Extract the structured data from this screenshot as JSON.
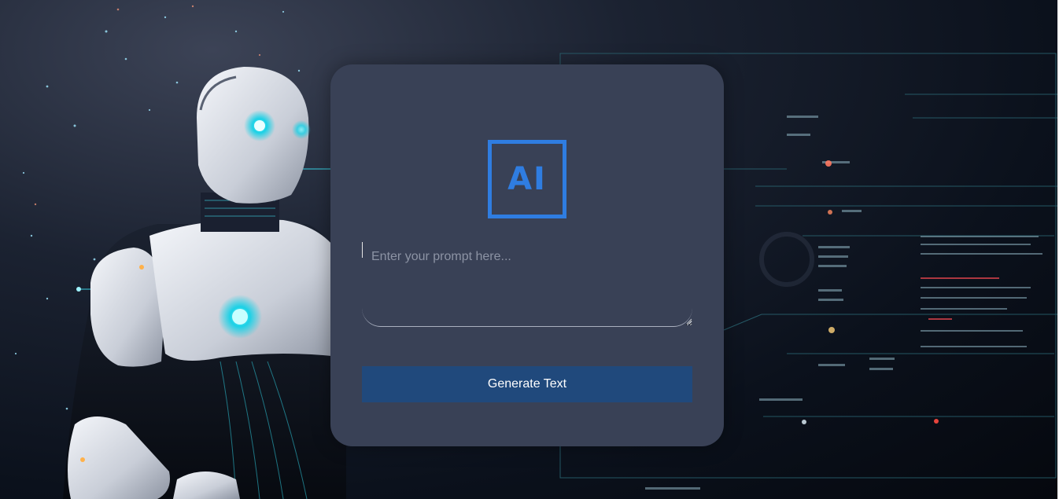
{
  "background": {
    "description_icon": "robot-illustration",
    "accent": "#2ad7e6"
  },
  "card": {
    "logo_text": "AI",
    "logo_color": "#2f7de1",
    "prompt": {
      "value": "",
      "placeholder": "Enter your prompt here..."
    },
    "generate_label": "Generate Text",
    "button_color": "#20497c",
    "card_color": "#394156"
  }
}
